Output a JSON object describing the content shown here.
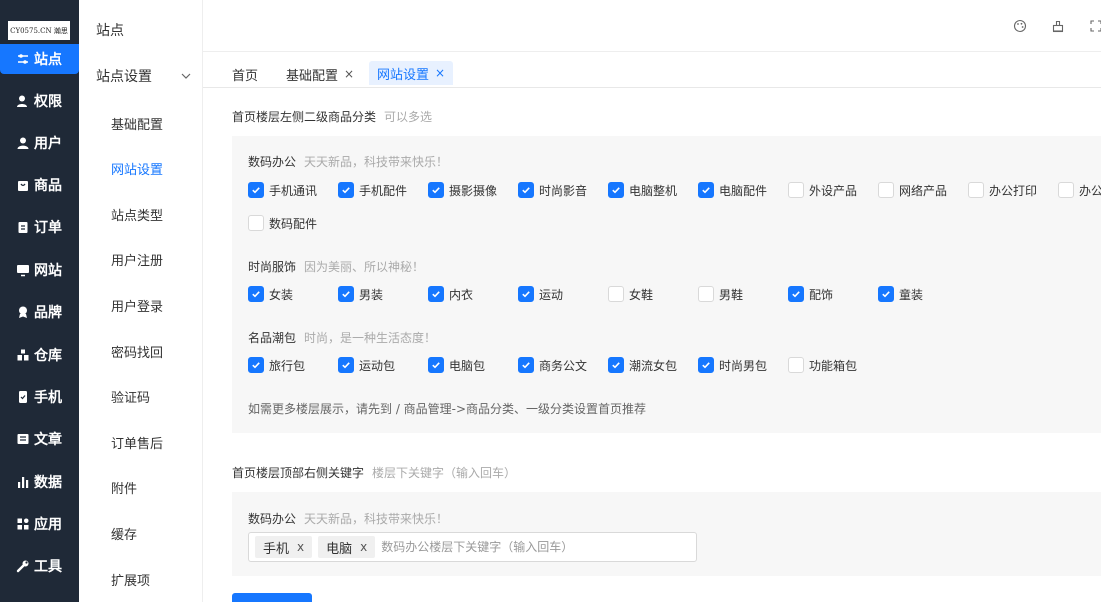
{
  "logo_text": "CY0575.CN 瀚思",
  "rail": [
    {
      "label": "站点",
      "icon": "sliders-icon",
      "active": true
    },
    {
      "label": "权限",
      "icon": "user-key-icon"
    },
    {
      "label": "用户",
      "icon": "user-icon"
    },
    {
      "label": "商品",
      "icon": "shopping-bag-icon"
    },
    {
      "label": "订单",
      "icon": "clipboard-icon"
    },
    {
      "label": "网站",
      "icon": "monitor-icon"
    },
    {
      "label": "品牌",
      "icon": "badge-icon"
    },
    {
      "label": "仓库",
      "icon": "warehouse-icon"
    },
    {
      "label": "手机",
      "icon": "phone-icon"
    },
    {
      "label": "文章",
      "icon": "article-icon"
    },
    {
      "label": "数据",
      "icon": "bar-chart-icon"
    },
    {
      "label": "应用",
      "icon": "apps-icon"
    },
    {
      "label": "工具",
      "icon": "wrench-icon"
    }
  ],
  "submenu": {
    "title": "站点",
    "group": "站点设置",
    "items": [
      "基础配置",
      "网站设置",
      "站点类型",
      "用户注册",
      "用户登录",
      "密码找回",
      "验证码",
      "订单售后",
      "附件",
      "缓存",
      "扩展项"
    ],
    "active_index": 1
  },
  "tabs": [
    {
      "label": "首页",
      "closable": false
    },
    {
      "label": "基础配置",
      "closable": true
    },
    {
      "label": "网站设置",
      "closable": true,
      "active": true
    }
  ],
  "close_glyph": "×",
  "section1": {
    "label": "首页楼层左侧二级商品分类",
    "hint": "可以多选",
    "groups": [
      {
        "title": "数码办公",
        "hint": "天天新品，科技带来快乐！",
        "options": [
          {
            "label": "手机通讯",
            "checked": true
          },
          {
            "label": "手机配件",
            "checked": true
          },
          {
            "label": "摄影摄像",
            "checked": true
          },
          {
            "label": "时尚影音",
            "checked": true
          },
          {
            "label": "电脑整机",
            "checked": true
          },
          {
            "label": "电脑配件",
            "checked": true
          },
          {
            "label": "外设产品",
            "checked": false
          },
          {
            "label": "网络产品",
            "checked": false
          },
          {
            "label": "办公打印",
            "checked": false
          },
          {
            "label": "办公",
            "checked": false
          },
          {
            "label": "数码配件",
            "checked": false
          }
        ]
      },
      {
        "title": "时尚服饰",
        "hint": "因为美丽、所以神秘！",
        "options": [
          {
            "label": "女装",
            "checked": true
          },
          {
            "label": "男装",
            "checked": true
          },
          {
            "label": "内衣",
            "checked": true
          },
          {
            "label": "运动",
            "checked": true
          },
          {
            "label": "女鞋",
            "checked": false
          },
          {
            "label": "男鞋",
            "checked": false
          },
          {
            "label": "配饰",
            "checked": true
          },
          {
            "label": "童装",
            "checked": true
          }
        ]
      },
      {
        "title": "名品潮包",
        "hint": "时尚，是一种生活态度！",
        "options": [
          {
            "label": "旅行包",
            "checked": true
          },
          {
            "label": "运动包",
            "checked": true
          },
          {
            "label": "电脑包",
            "checked": true
          },
          {
            "label": "商务公文",
            "checked": true
          },
          {
            "label": "潮流女包",
            "checked": true
          },
          {
            "label": "时尚男包",
            "checked": true
          },
          {
            "label": "功能箱包",
            "checked": false
          }
        ]
      }
    ],
    "note": "如需更多楼层展示，请先到 / 商品管理->商品分类、一级分类设置首页推荐"
  },
  "section2": {
    "label": "首页楼层顶部右侧关键字",
    "hint": "楼层下关键字（输入回车）",
    "group_title": "数码办公",
    "group_hint": "天天新品，科技带来快乐！",
    "tags": [
      "手机",
      "电脑"
    ],
    "tag_close": "x",
    "placeholder": "数码办公楼层下关键字（输入回车）"
  },
  "colors": {
    "primary": "#1677ff",
    "rail": "#1f2937"
  }
}
